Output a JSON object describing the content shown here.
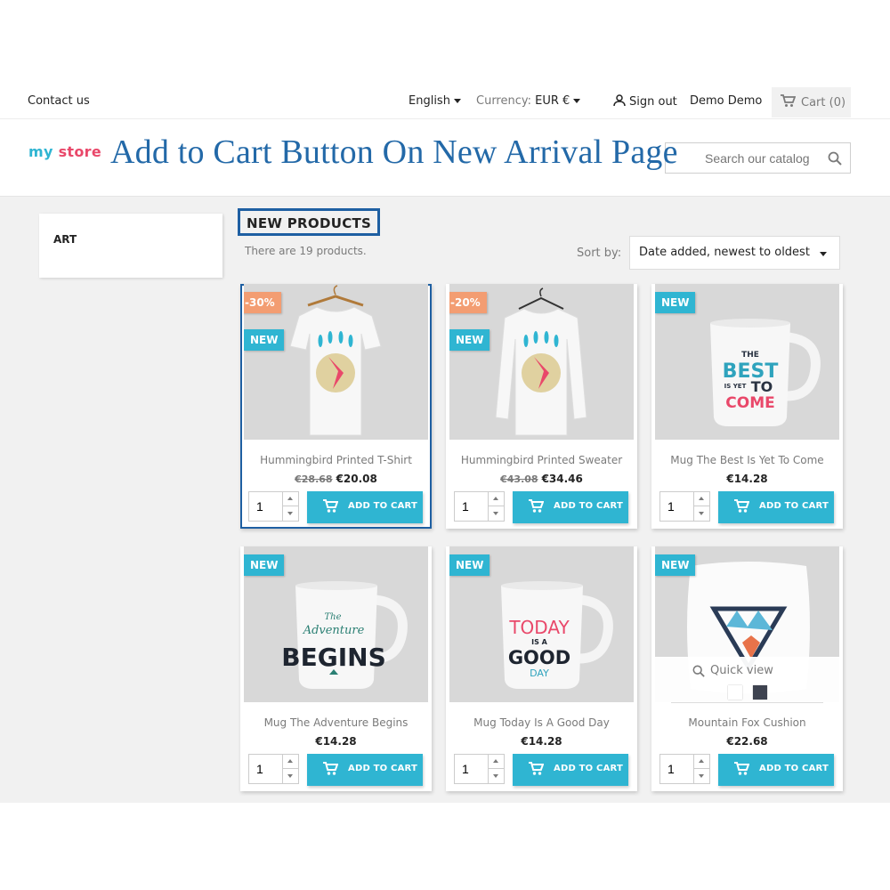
{
  "nav": {
    "contact": "Contact us",
    "language": "English",
    "currency_label": "Currency:",
    "currency_value": "EUR €",
    "sign_out": "Sign out",
    "user": "Demo Demo",
    "cart": "Cart (0)"
  },
  "header": {
    "logo_my": "my",
    "logo_store": "store",
    "overlay_title": "Add to Cart Button On New Arrival Page",
    "search_placeholder": "Search our catalog"
  },
  "sidebar": {
    "category": "ART"
  },
  "listing": {
    "title": "NEW PRODUCTS",
    "count": "There are 19 products.",
    "sort_label": "Sort by:",
    "sort_value": "Date added, newest to oldest"
  },
  "products": [
    {
      "name": "Hummingbird Printed T-Shirt",
      "regular_price": "€28.68",
      "price": "€20.08",
      "discount": "-30%",
      "flag": "NEW",
      "qty": "1",
      "button": "ADD TO CART"
    },
    {
      "name": "Hummingbird Printed Sweater",
      "regular_price": "€43.08",
      "price": "€34.46",
      "discount": "-20%",
      "flag": "NEW",
      "qty": "1",
      "button": "ADD TO CART"
    },
    {
      "name": "Mug The Best Is Yet To Come",
      "price": "€14.28",
      "flag": "NEW",
      "qty": "1",
      "button": "ADD TO CART"
    },
    {
      "name": "Mug The Adventure Begins",
      "price": "€14.28",
      "flag": "NEW",
      "qty": "1",
      "button": "ADD TO CART"
    },
    {
      "name": "Mug Today Is A Good Day",
      "price": "€14.28",
      "flag": "NEW",
      "qty": "1",
      "button": "ADD TO CART"
    },
    {
      "name": "Mountain Fox Cushion",
      "price": "€22.68",
      "flag": "NEW",
      "qty": "1",
      "button": "ADD TO CART",
      "quick_view": "Quick view",
      "swatches": [
        "#ffffff",
        "#3e4350"
      ]
    }
  ],
  "artwork": {
    "mug_best": [
      "THE",
      "BEST",
      "IS YET",
      "TO",
      "COME"
    ],
    "mug_adventure": [
      "The",
      "Adventure",
      "BEGINS"
    ],
    "mug_today": [
      "TODAY",
      "IS A",
      "GOOD",
      "DAY"
    ]
  },
  "colors": {
    "accent": "#2fb5d2",
    "discount": "#f39d72",
    "highlight": "#1e5fa2",
    "title_overlay": "#2369a8"
  }
}
